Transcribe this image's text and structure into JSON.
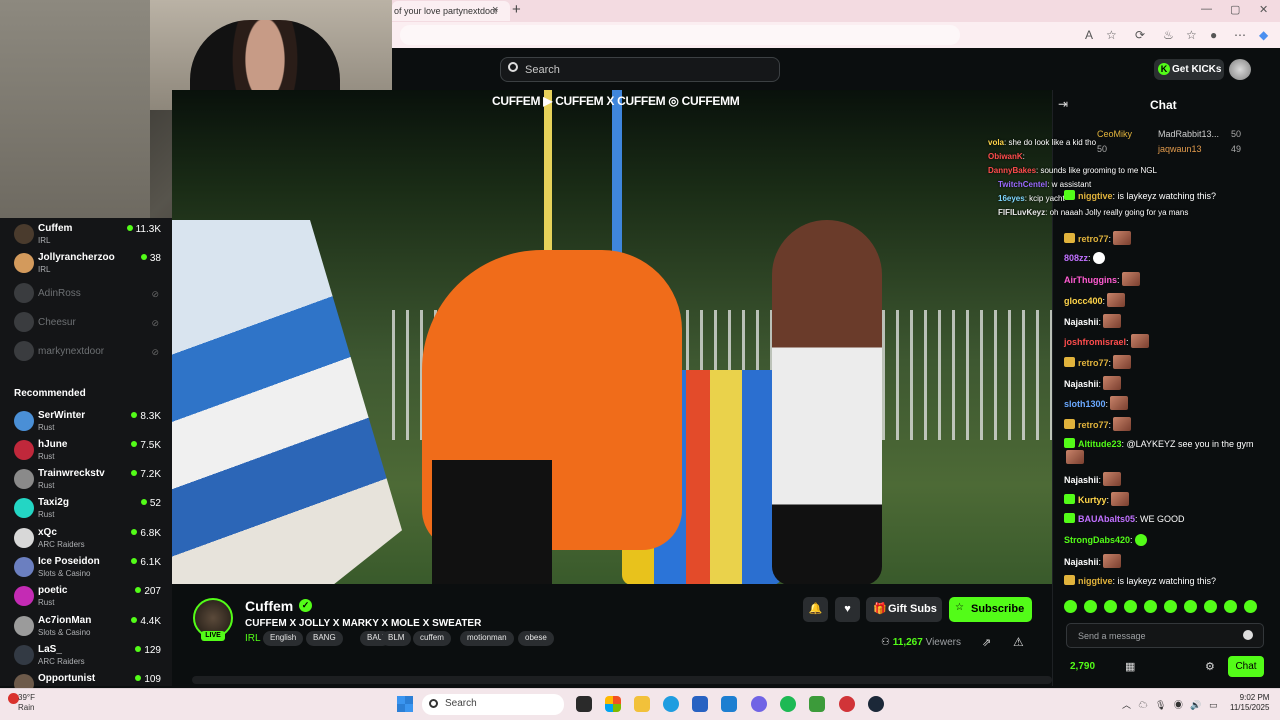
{
  "browser": {
    "tab_title": "of your love partynextdoor",
    "tab_close": "×",
    "new_tab": "+"
  },
  "header": {
    "search_placeholder": "Search",
    "get_kicks_label": "Get KICKs",
    "kicks_icon": "K"
  },
  "sidebar": {
    "following": [
      {
        "name": "Cuffem",
        "category": "IRL",
        "viewers": "11.3K",
        "live": true,
        "color": "#4a3b2d"
      },
      {
        "name": "Jollyrancherzoo",
        "category": "IRL",
        "viewers": "38",
        "live": true,
        "color": "#d39a5c"
      },
      {
        "name": "AdinRoss",
        "live": false
      },
      {
        "name": "Cheesur",
        "live": false
      },
      {
        "name": "markynextdoor",
        "live": false
      }
    ],
    "recommended_title": "Recommended",
    "recommended": [
      {
        "name": "SerWinter",
        "category": "Rust",
        "viewers": "8.3K",
        "color": "#4a8fd6"
      },
      {
        "name": "hJune",
        "category": "Rust",
        "viewers": "7.5K",
        "color": "#c0283b"
      },
      {
        "name": "Trainwreckstv",
        "category": "Rust",
        "viewers": "7.2K",
        "color": "#8a8a8a"
      },
      {
        "name": "Taxi2g",
        "category": "Rust",
        "viewers": "52",
        "color": "#23d6c4"
      },
      {
        "name": "xQc",
        "category": "ARC Raiders",
        "viewers": "6.8K",
        "color": "#d8d8d8"
      },
      {
        "name": "Ice Poseidon",
        "category": "Slots & Casino",
        "viewers": "6.1K",
        "color": "#6b7fc0"
      },
      {
        "name": "poetic",
        "category": "Rust",
        "viewers": "207",
        "color": "#c42bb4"
      },
      {
        "name": "Ac7ionMan",
        "category": "Slots & Casino",
        "viewers": "4.4K",
        "color": "#9b9b9b"
      },
      {
        "name": "LaS_",
        "category": "ARC Raiders",
        "viewers": "129",
        "color": "#333a44"
      },
      {
        "name": "Opportunist",
        "category": "",
        "viewers": "109",
        "color": "#6d5a4a"
      }
    ]
  },
  "video": {
    "banner": "CUFFEM ▶ CUFFEM X CUFFEM ◎ CUFFEMM",
    "overlay_chat": [
      {
        "user": "vola",
        "text": ": she do look like a kid tho",
        "color": "#ffd54a"
      },
      {
        "user": "ObiwanK",
        "text": ":",
        "color": "#ff4d4d"
      },
      {
        "user": "DannyBakes",
        "text": ": sounds like grooming to me NGL",
        "color": "#ff4d4d"
      },
      {
        "user": "TwitchCentel",
        "text": ": w assistant",
        "color": "#9b6bff"
      },
      {
        "user": "16eyes",
        "text": ": kcip yacht",
        "color": "#7fd7ff"
      },
      {
        "user": "FIFILuvKeyz",
        "text": ": oh naaah Jolly really going for ya mans",
        "color": "#e8e8e8"
      }
    ]
  },
  "stream": {
    "streamer": "Cuffem",
    "live_label": "LIVE",
    "verified_icon": "✓",
    "title": "CUFFEM X JOLLY X MARKY X MOLE X SWEATER",
    "category": "IRL",
    "tags": [
      "English",
      "BANG",
      "BAU",
      "BLM",
      "cuffem",
      "motionman",
      "obese"
    ],
    "gift_subs_label": "Gift Subs",
    "subscribe_label": "Subscribe",
    "viewer_count": "11,267",
    "viewers_label": "Viewers"
  },
  "chat": {
    "title": "Chat",
    "pinned": [
      {
        "user": "CeoMiky",
        "count": "50",
        "color": "#e1b33c"
      },
      {
        "user": "MadRabbit13...",
        "count": "50",
        "color": "#cfcfcf"
      },
      {
        "user": "jaqwaun13",
        "count": "49",
        "color": "#e19a4c"
      }
    ],
    "messages": [
      {
        "user": "niggtive",
        "text": ": is laykeyz watching this?",
        "color": "#e1b33c",
        "badge": "g",
        "emote": ""
      },
      {
        "user": "retro77",
        "text": ":",
        "color": "#e1b33c",
        "badge": "y",
        "emote": "face"
      },
      {
        "user": "808zz",
        "text": ":",
        "color": "#c070ff",
        "badge": "",
        "emote": "skull"
      },
      {
        "user": "AirThuggins",
        "text": ":",
        "color": "#ff5bd1",
        "badge": "",
        "emote": "face"
      },
      {
        "user": "glocc400",
        "text": ":",
        "color": "#ffd54a",
        "badge": "",
        "emote": "face"
      },
      {
        "user": "Najashii",
        "text": ":",
        "color": "#ffffff",
        "badge": "",
        "emote": "face"
      },
      {
        "user": "joshfromisrael",
        "text": ":",
        "color": "#ff4d4d",
        "badge": "",
        "emote": "face"
      },
      {
        "user": "retro77",
        "text": ":",
        "color": "#e1b33c",
        "badge": "y",
        "emote": "face"
      },
      {
        "user": "Najashii",
        "text": ":",
        "color": "#ffffff",
        "badge": "",
        "emote": "face"
      },
      {
        "user": "sloth1300",
        "text": ":",
        "color": "#6aa8ff",
        "badge": "",
        "emote": "face"
      },
      {
        "user": "retro77",
        "text": ":",
        "color": "#e1b33c",
        "badge": "y",
        "emote": "face"
      },
      {
        "user": "Altitude23",
        "text": ": @LAYKEYZ see you in the gym",
        "color": "#53fc18",
        "badge": "g",
        "emote": "face"
      },
      {
        "user": "Najashii",
        "text": ":",
        "color": "#ffffff",
        "badge": "",
        "emote": "face"
      },
      {
        "user": "Kurtyy",
        "text": ":",
        "color": "#ffd54a",
        "badge": "g",
        "emote": "face"
      },
      {
        "user": "BAUAbalts05",
        "text": ": WE GOOD",
        "color": "#c070ff",
        "badge": "g",
        "emote": ""
      },
      {
        "user": "StrongDabs420",
        "text": ":",
        "color": "#53fc18",
        "badge": "",
        "emote": "green"
      },
      {
        "user": "Najashii",
        "text": ":",
        "color": "#ffffff",
        "badge": "",
        "emote": "face"
      },
      {
        "user": "niggtive",
        "text": ": is laykeyz watching this?",
        "color": "#e1b33c",
        "badge": "y",
        "emote": ""
      }
    ],
    "input_placeholder": "Send a message",
    "points": "2,790",
    "send_label": "Chat"
  },
  "taskbar": {
    "weather_temp": "39°F",
    "weather_desc": "Rain",
    "search_label": "Search",
    "time": "9:02 PM",
    "date": "11/15/2025"
  }
}
